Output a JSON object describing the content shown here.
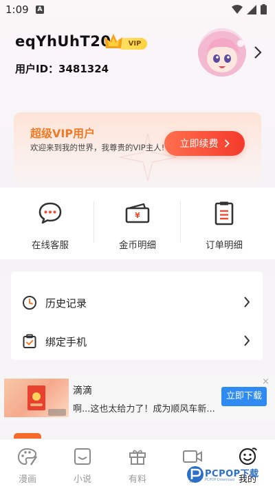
{
  "status_bar": {
    "time": "1:09",
    "notification_glyph": "A"
  },
  "profile": {
    "username": "eqYhUhT20",
    "vip_badge": "VIP",
    "user_id": "用户ID：3481324"
  },
  "vip_card": {
    "title": "超级VIP用户",
    "description": "欢迎来到我的世界，我尊贵的VIP主人!",
    "renew_button": "立即续费"
  },
  "quick_actions": [
    {
      "label": "在线客服",
      "icon": "chat-bubble-icon"
    },
    {
      "label": "金币明细",
      "icon": "wallet-icon"
    },
    {
      "label": "订单明细",
      "icon": "clipboard-icon"
    }
  ],
  "menu": [
    {
      "label": "历史记录",
      "icon": "clock-icon"
    },
    {
      "label": "绑定手机",
      "icon": "shield-check-icon"
    }
  ],
  "ad": {
    "title": "滴滴",
    "description": "啊...这也太给力了！成为顺风车新...",
    "button": "立即下载",
    "close": "×"
  },
  "bottom_nav": [
    {
      "label": "漫画",
      "icon": "palette-icon",
      "active": false
    },
    {
      "label": "小说",
      "icon": "book-icon",
      "active": false
    },
    {
      "label": "有料",
      "icon": "gift-icon",
      "active": false
    },
    {
      "label": "视",
      "icon": "video-icon",
      "active": false
    },
    {
      "label": "我的",
      "icon": "smiley-icon",
      "active": true
    }
  ],
  "watermark": {
    "text": "PCPOP下载",
    "sub": "PCPOP Download"
  },
  "colors": {
    "accent_orange": "#f17924",
    "renew_gradient_start": "#ff6f4e",
    "renew_gradient_end": "#f43a2b",
    "ad_button_blue": "#2f8bf2",
    "vip_gold": "#ffd23f"
  }
}
